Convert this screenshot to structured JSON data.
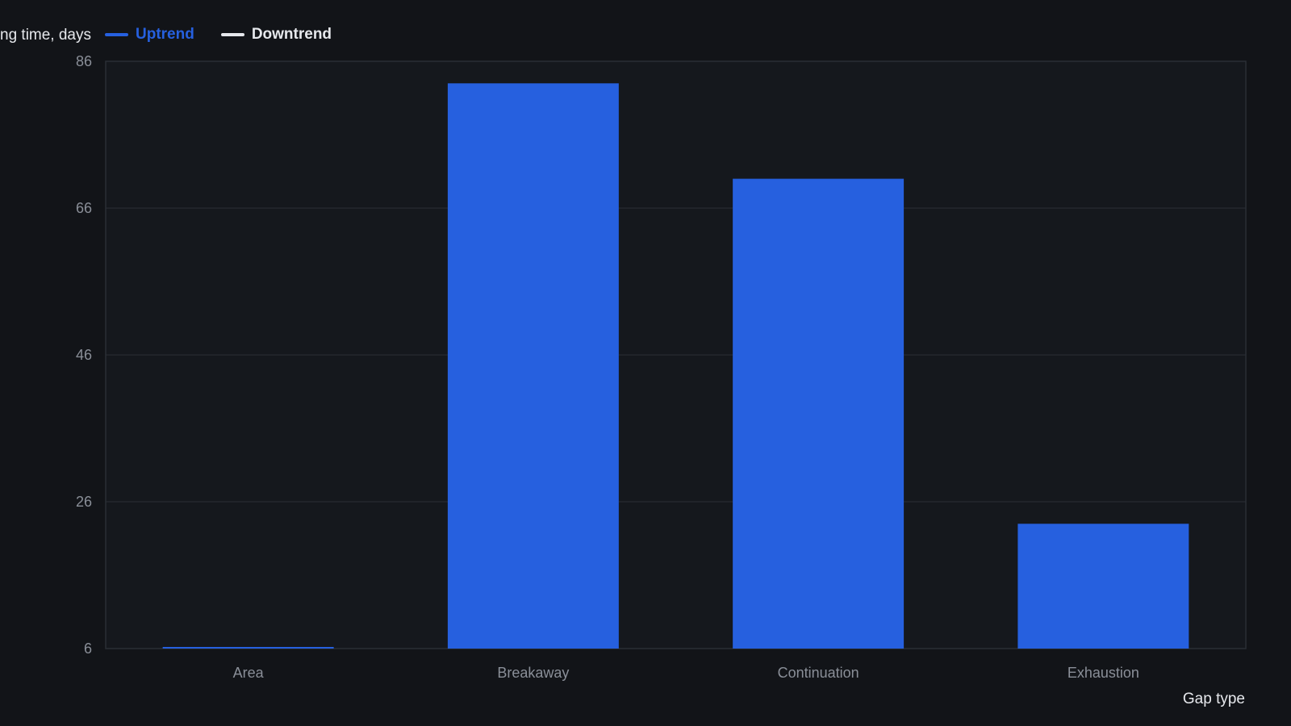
{
  "chart_data": {
    "type": "bar",
    "ylabel": "ng time, days",
    "xlabel": "Gap type",
    "categories": [
      "Area",
      "Breakaway",
      "Continuation",
      "Exhaustion"
    ],
    "series": [
      {
        "name": "Uptrend",
        "values": [
          6,
          83,
          70,
          23
        ]
      },
      {
        "name": "Downtrend",
        "values": [
          0,
          0,
          0,
          0
        ]
      }
    ],
    "ylim": [
      6,
      86
    ],
    "yticks": [
      6,
      26,
      46,
      66,
      86
    ],
    "grid": true,
    "legend_position": "top-left",
    "colors": {
      "Uptrend": "#2660df",
      "Downtrend": "#e6e8ec",
      "background": "#121418",
      "plot_background": "#15181d",
      "grid": "#2a2e35",
      "tick_text": "#8a8f98",
      "label_text": "#e6e8ec"
    }
  }
}
